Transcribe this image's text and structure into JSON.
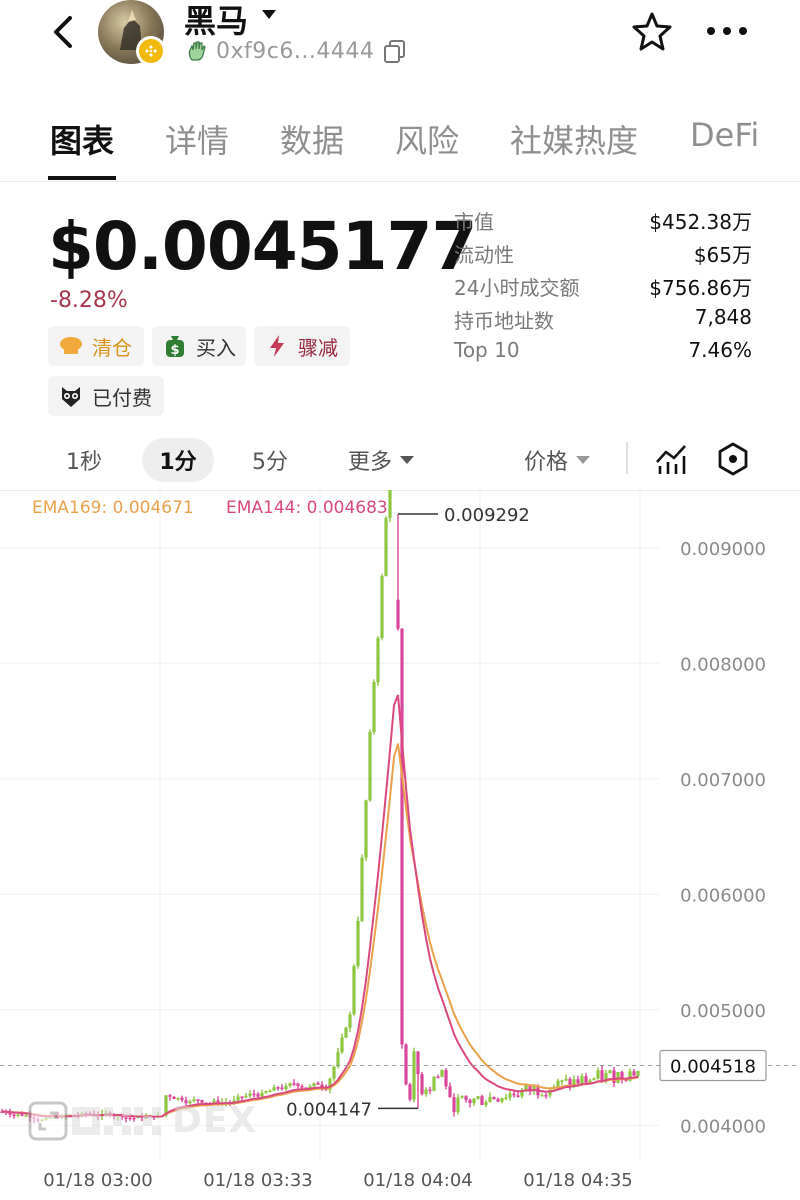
{
  "header": {
    "token_name": "黑马",
    "address": "0xf9c6...4444"
  },
  "tabs": [
    {
      "label": "图表",
      "active": true
    },
    {
      "label": "详情",
      "active": false
    },
    {
      "label": "数据",
      "active": false
    },
    {
      "label": "风险",
      "active": false
    },
    {
      "label": "社媒热度",
      "active": false
    },
    {
      "label": "DeFi",
      "active": false
    }
  ],
  "price": {
    "value": "$0.0045177",
    "change": "-8.28%"
  },
  "tags": {
    "clear": "清仓",
    "buy": "买入",
    "dump": "骤减",
    "paid": "已付费"
  },
  "stats": [
    {
      "label": "市值",
      "value": "$452.38万"
    },
    {
      "label": "流动性",
      "value": "$65万"
    },
    {
      "label": "24小时成交额",
      "value": "$756.86万"
    },
    {
      "label": "持币地址数",
      "value": "7,848"
    },
    {
      "label": "Top 10",
      "value": "7.46%"
    }
  ],
  "intervals": {
    "sec1": "1秒",
    "min1": "1分",
    "min5": "5分",
    "more": "更多",
    "price": "价格"
  },
  "ema": {
    "ema169": "EMA169: 0.004671",
    "ema144": "EMA144: 0.004683"
  },
  "watermark": "DEX",
  "colors": {
    "up": "#8dc63f",
    "down": "#d9479c",
    "ema169": "#e9a14a",
    "ema144": "#d9497f",
    "negative_change": "#a6364d"
  },
  "chart_data": {
    "type": "candlestick",
    "y_ticks": [
      "0.009000",
      "0.008000",
      "0.007000",
      "0.006000",
      "0.005000",
      "0.004000"
    ],
    "x_ticks": [
      "01/18 03:00",
      "01/18 03:33",
      "01/18 04:04",
      "01/18 04:35"
    ],
    "ylim": [
      0.0037,
      0.0095
    ],
    "high_label": "0.009292",
    "low_label": "0.004147",
    "current_price_label": "0.004518",
    "ema169_last": 0.004671,
    "ema144_last": 0.004683
  }
}
